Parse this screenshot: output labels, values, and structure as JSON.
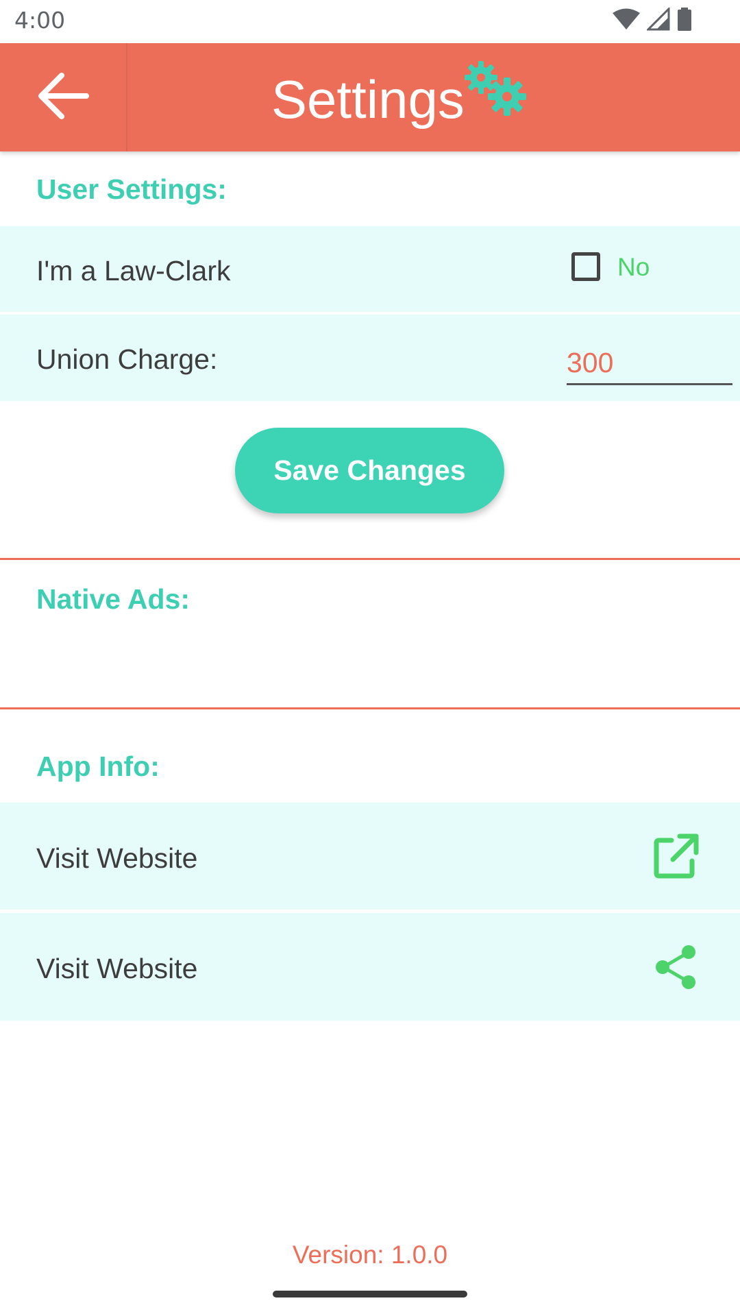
{
  "status_bar": {
    "time": "4:00",
    "icons": [
      "wifi-icon",
      "signal-icon",
      "battery-icon"
    ]
  },
  "app_bar": {
    "title": "Settings",
    "back_icon": "arrow-back-icon",
    "title_icon": "gears-icon",
    "color": "#ec6e58"
  },
  "user_settings": {
    "header": "User Settings:",
    "law_clerk": {
      "label": "I'm a Law-Clark",
      "checked": false,
      "state_label": "No"
    },
    "union_charge": {
      "label": "Union Charge:",
      "value": "300"
    },
    "save_label": "Save Changes"
  },
  "native_ads": {
    "header": "Native Ads:"
  },
  "app_info": {
    "header": "App Info:",
    "items": [
      {
        "label": "Visit Website",
        "icon": "open-external-icon"
      },
      {
        "label": "Visit Website",
        "icon": "share-icon"
      }
    ]
  },
  "footer": {
    "version": "Version: 1.0.0"
  },
  "colors": {
    "accent": "#3ecfb3",
    "primary": "#ec6e58",
    "row_background": "#e6fcfa",
    "icon_green": "#4cd36a"
  }
}
